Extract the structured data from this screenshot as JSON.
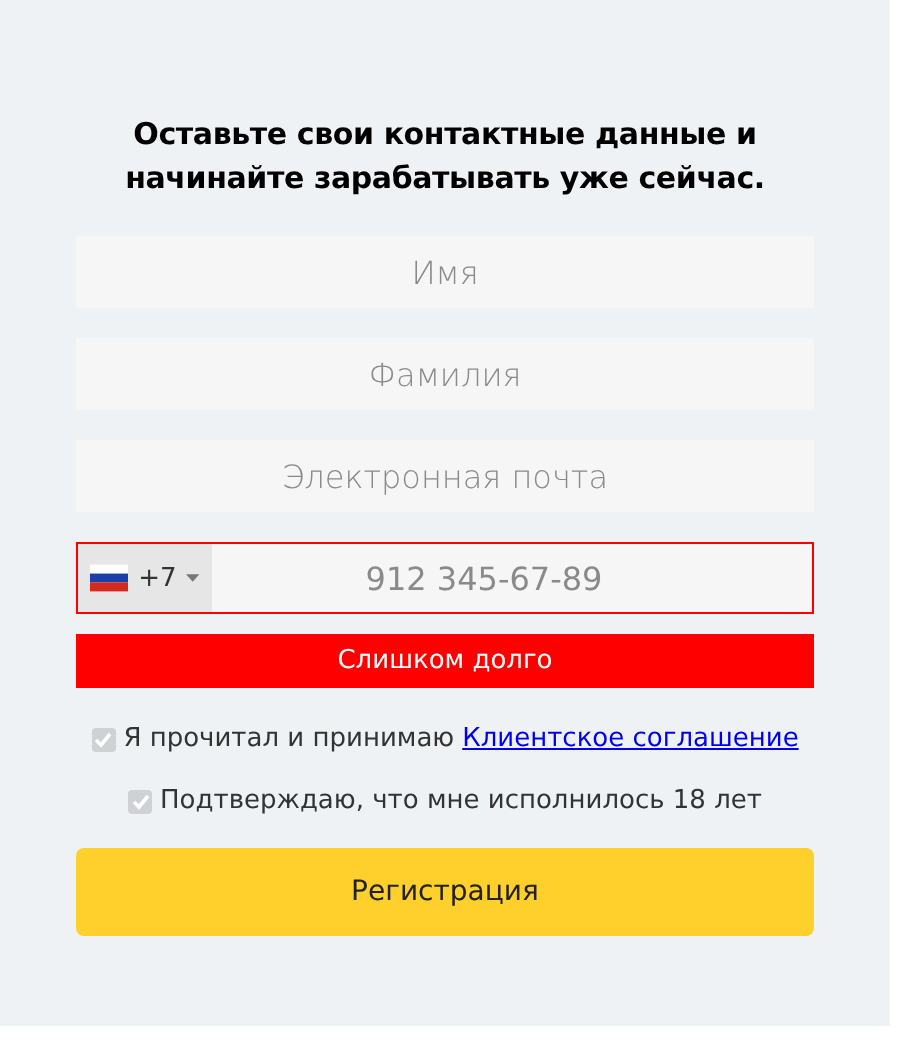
{
  "heading": "Оставьте свои контактные данные и начинайте зарабатывать уже сейчас.",
  "fields": [
    {
      "placeholder": "Имя"
    },
    {
      "placeholder": "Фамилия"
    },
    {
      "placeholder": "Электронная почта"
    }
  ],
  "phone": {
    "country_code": "+7",
    "placeholder": "912 345-67-89",
    "invalid": true
  },
  "error": "Слишком долго",
  "agreements": [
    {
      "text": "Я прочитал и принимаю ",
      "link": "Клиентское соглашение",
      "checked": true,
      "disabled": true
    },
    {
      "text": "Подтверждаю, что мне исполнилось 18 лет",
      "checked": true,
      "disabled": true
    }
  ],
  "submit": "Регистрация"
}
